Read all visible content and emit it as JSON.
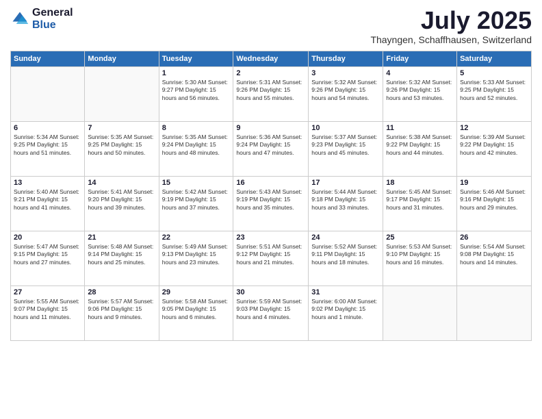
{
  "logo": {
    "general": "General",
    "blue": "Blue"
  },
  "title": "July 2025",
  "location": "Thayngen, Schaffhausen, Switzerland",
  "days_of_week": [
    "Sunday",
    "Monday",
    "Tuesday",
    "Wednesday",
    "Thursday",
    "Friday",
    "Saturday"
  ],
  "weeks": [
    [
      {
        "day": "",
        "info": ""
      },
      {
        "day": "",
        "info": ""
      },
      {
        "day": "1",
        "info": "Sunrise: 5:30 AM\nSunset: 9:27 PM\nDaylight: 15 hours and 56 minutes."
      },
      {
        "day": "2",
        "info": "Sunrise: 5:31 AM\nSunset: 9:26 PM\nDaylight: 15 hours and 55 minutes."
      },
      {
        "day": "3",
        "info": "Sunrise: 5:32 AM\nSunset: 9:26 PM\nDaylight: 15 hours and 54 minutes."
      },
      {
        "day": "4",
        "info": "Sunrise: 5:32 AM\nSunset: 9:26 PM\nDaylight: 15 hours and 53 minutes."
      },
      {
        "day": "5",
        "info": "Sunrise: 5:33 AM\nSunset: 9:25 PM\nDaylight: 15 hours and 52 minutes."
      }
    ],
    [
      {
        "day": "6",
        "info": "Sunrise: 5:34 AM\nSunset: 9:25 PM\nDaylight: 15 hours and 51 minutes."
      },
      {
        "day": "7",
        "info": "Sunrise: 5:35 AM\nSunset: 9:25 PM\nDaylight: 15 hours and 50 minutes."
      },
      {
        "day": "8",
        "info": "Sunrise: 5:35 AM\nSunset: 9:24 PM\nDaylight: 15 hours and 48 minutes."
      },
      {
        "day": "9",
        "info": "Sunrise: 5:36 AM\nSunset: 9:24 PM\nDaylight: 15 hours and 47 minutes."
      },
      {
        "day": "10",
        "info": "Sunrise: 5:37 AM\nSunset: 9:23 PM\nDaylight: 15 hours and 45 minutes."
      },
      {
        "day": "11",
        "info": "Sunrise: 5:38 AM\nSunset: 9:22 PM\nDaylight: 15 hours and 44 minutes."
      },
      {
        "day": "12",
        "info": "Sunrise: 5:39 AM\nSunset: 9:22 PM\nDaylight: 15 hours and 42 minutes."
      }
    ],
    [
      {
        "day": "13",
        "info": "Sunrise: 5:40 AM\nSunset: 9:21 PM\nDaylight: 15 hours and 41 minutes."
      },
      {
        "day": "14",
        "info": "Sunrise: 5:41 AM\nSunset: 9:20 PM\nDaylight: 15 hours and 39 minutes."
      },
      {
        "day": "15",
        "info": "Sunrise: 5:42 AM\nSunset: 9:19 PM\nDaylight: 15 hours and 37 minutes."
      },
      {
        "day": "16",
        "info": "Sunrise: 5:43 AM\nSunset: 9:19 PM\nDaylight: 15 hours and 35 minutes."
      },
      {
        "day": "17",
        "info": "Sunrise: 5:44 AM\nSunset: 9:18 PM\nDaylight: 15 hours and 33 minutes."
      },
      {
        "day": "18",
        "info": "Sunrise: 5:45 AM\nSunset: 9:17 PM\nDaylight: 15 hours and 31 minutes."
      },
      {
        "day": "19",
        "info": "Sunrise: 5:46 AM\nSunset: 9:16 PM\nDaylight: 15 hours and 29 minutes."
      }
    ],
    [
      {
        "day": "20",
        "info": "Sunrise: 5:47 AM\nSunset: 9:15 PM\nDaylight: 15 hours and 27 minutes."
      },
      {
        "day": "21",
        "info": "Sunrise: 5:48 AM\nSunset: 9:14 PM\nDaylight: 15 hours and 25 minutes."
      },
      {
        "day": "22",
        "info": "Sunrise: 5:49 AM\nSunset: 9:13 PM\nDaylight: 15 hours and 23 minutes."
      },
      {
        "day": "23",
        "info": "Sunrise: 5:51 AM\nSunset: 9:12 PM\nDaylight: 15 hours and 21 minutes."
      },
      {
        "day": "24",
        "info": "Sunrise: 5:52 AM\nSunset: 9:11 PM\nDaylight: 15 hours and 18 minutes."
      },
      {
        "day": "25",
        "info": "Sunrise: 5:53 AM\nSunset: 9:10 PM\nDaylight: 15 hours and 16 minutes."
      },
      {
        "day": "26",
        "info": "Sunrise: 5:54 AM\nSunset: 9:08 PM\nDaylight: 15 hours and 14 minutes."
      }
    ],
    [
      {
        "day": "27",
        "info": "Sunrise: 5:55 AM\nSunset: 9:07 PM\nDaylight: 15 hours and 11 minutes."
      },
      {
        "day": "28",
        "info": "Sunrise: 5:57 AM\nSunset: 9:06 PM\nDaylight: 15 hours and 9 minutes."
      },
      {
        "day": "29",
        "info": "Sunrise: 5:58 AM\nSunset: 9:05 PM\nDaylight: 15 hours and 6 minutes."
      },
      {
        "day": "30",
        "info": "Sunrise: 5:59 AM\nSunset: 9:03 PM\nDaylight: 15 hours and 4 minutes."
      },
      {
        "day": "31",
        "info": "Sunrise: 6:00 AM\nSunset: 9:02 PM\nDaylight: 15 hours and 1 minute."
      },
      {
        "day": "",
        "info": ""
      },
      {
        "day": "",
        "info": ""
      }
    ]
  ]
}
